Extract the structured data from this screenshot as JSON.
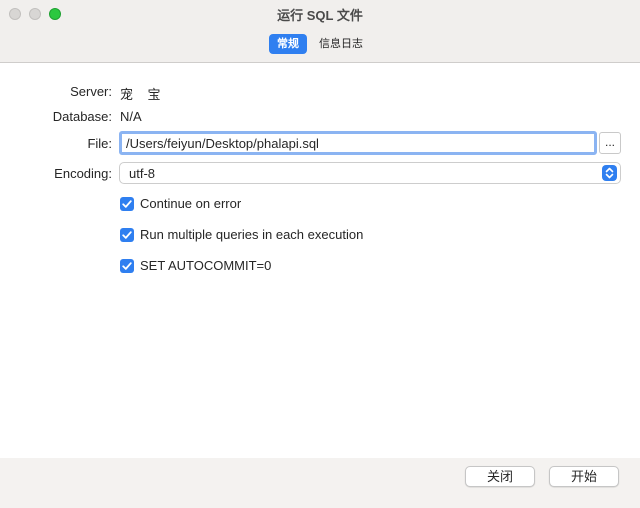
{
  "window": {
    "title": "运行 SQL 文件"
  },
  "tabs": [
    {
      "label": "常规",
      "active": true
    },
    {
      "label": "信息日志",
      "active": false
    }
  ],
  "form": {
    "server": {
      "label": "Server:",
      "value": "宠    宝"
    },
    "database": {
      "label": "Database:",
      "value": "N/A"
    },
    "file": {
      "label": "File:",
      "value": "/Users/feiyun/Desktop/phalapi.sql",
      "browse_label": "..."
    },
    "encoding": {
      "label": "Encoding:",
      "value": "utf-8"
    }
  },
  "options": [
    {
      "label": "Continue on error",
      "checked": true
    },
    {
      "label": "Run multiple queries in each execution",
      "checked": true
    },
    {
      "label": "SET AUTOCOMMIT=0",
      "checked": true
    }
  ],
  "buttons": {
    "close": "关闭",
    "start": "开始"
  },
  "colors": {
    "accent": "#2f7ff0",
    "focus_ring": "#8bb4f2",
    "titlebar_bg": "#f1efed"
  }
}
